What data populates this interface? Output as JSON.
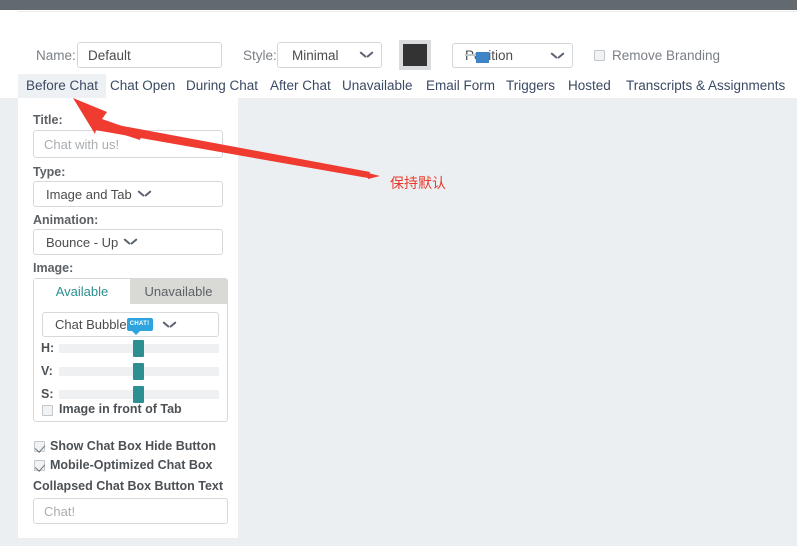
{
  "toolbar": {
    "name_label": "Name:",
    "name_value": "Default",
    "style_label": "Style:",
    "style_value": "Minimal",
    "color_swatch": "#333333",
    "position_label": "Position",
    "remove_branding_label": "Remove Branding",
    "remove_branding_checked": false
  },
  "tabs": [
    {
      "label": "Before Chat",
      "active": true
    },
    {
      "label": "Chat Open",
      "active": false
    },
    {
      "label": "During Chat",
      "active": false
    },
    {
      "label": "After Chat",
      "active": false
    },
    {
      "label": "Unavailable",
      "active": false
    },
    {
      "label": "Email Form",
      "active": false
    },
    {
      "label": "Triggers",
      "active": false
    },
    {
      "label": "Hosted",
      "active": false
    },
    {
      "label": "Transcripts & Assignments",
      "active": false
    }
  ],
  "panel": {
    "title_label": "Title:",
    "title_placeholder": "Chat with us!",
    "title_value": "",
    "type_label": "Type:",
    "type_value": "Image and Tab",
    "animation_label": "Animation:",
    "animation_value": "Bounce - Up",
    "image_label": "Image:",
    "image_tabs": [
      {
        "label": "Available",
        "active": true
      },
      {
        "label": "Unavailable",
        "active": false
      }
    ],
    "image_select_value": "Chat Bubble",
    "image_badge_text": "CHAT!",
    "sliders": [
      {
        "label": "H:",
        "value": 50
      },
      {
        "label": "V:",
        "value": 50
      },
      {
        "label": "S:",
        "value": 50
      }
    ],
    "image_front_label": "Image in front of Tab",
    "image_front_checked": false,
    "show_hide_button_label": "Show Chat Box Hide Button",
    "show_hide_button_checked": true,
    "mobile_optimized_label": "Mobile-Optimized Chat Box",
    "mobile_optimized_checked": true,
    "collapsed_text_label": "Collapsed Chat Box Button Text",
    "collapsed_text_placeholder": "Chat!",
    "collapsed_text_value": ""
  },
  "annotation": {
    "text": "保持默认",
    "color": "#e8392c"
  }
}
